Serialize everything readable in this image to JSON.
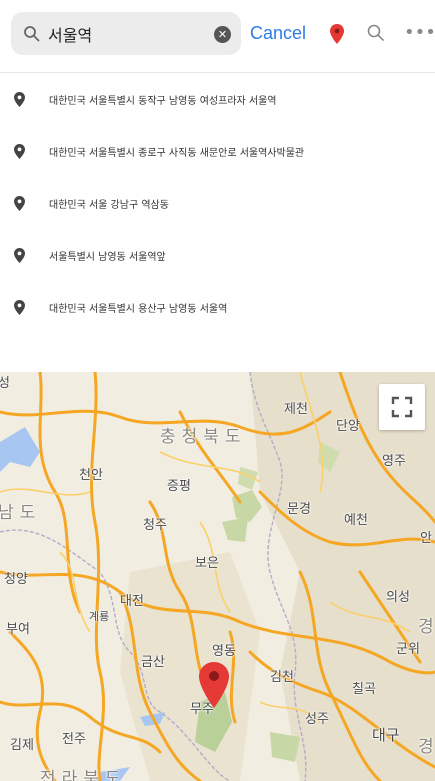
{
  "search": {
    "value": "서울역",
    "clear_label": "✕",
    "cancel_label": "Cancel"
  },
  "topbar": {
    "more_label": "•••"
  },
  "results": [
    {
      "text": "대한민국 서울특별시 동작구 남영동 여성프라자 서울역"
    },
    {
      "text": "대한민국 서울특별시 종로구 사직동 새문안로 서울역사박물관"
    },
    {
      "text": "대한민국 서울 강남구 역삼동"
    },
    {
      "text": "서울특별시 남영동 서울역앞"
    },
    {
      "text": "대한민국 서울특별시 용산구 남영동 서울역"
    }
  ],
  "map": {
    "labels": {
      "l1": "성",
      "l2": "제천",
      "l3": "충청북도",
      "l4": "단양",
      "l5": "영주",
      "l6": "천안",
      "l7": "증평",
      "l8": "남도",
      "l9": "문경",
      "l10": "청주",
      "l11": "예천",
      "l12": "안",
      "l13": "보은",
      "l14": "청양",
      "l15": "대전",
      "l16": "계룡",
      "l17": "의성",
      "l18": "부여",
      "l19": "영동",
      "l20": "경",
      "l21": "금산",
      "l22": "군위",
      "l23": "김천",
      "l24": "칠곡",
      "l25": "무주",
      "l26": "성주",
      "l27": "김제",
      "l28": "전주",
      "l29": "대구",
      "l30": "전라북도",
      "l31": "경"
    }
  },
  "colors": {
    "accent": "#2d7be5",
    "pin_red": "#e53935",
    "road": "#f5a623"
  }
}
